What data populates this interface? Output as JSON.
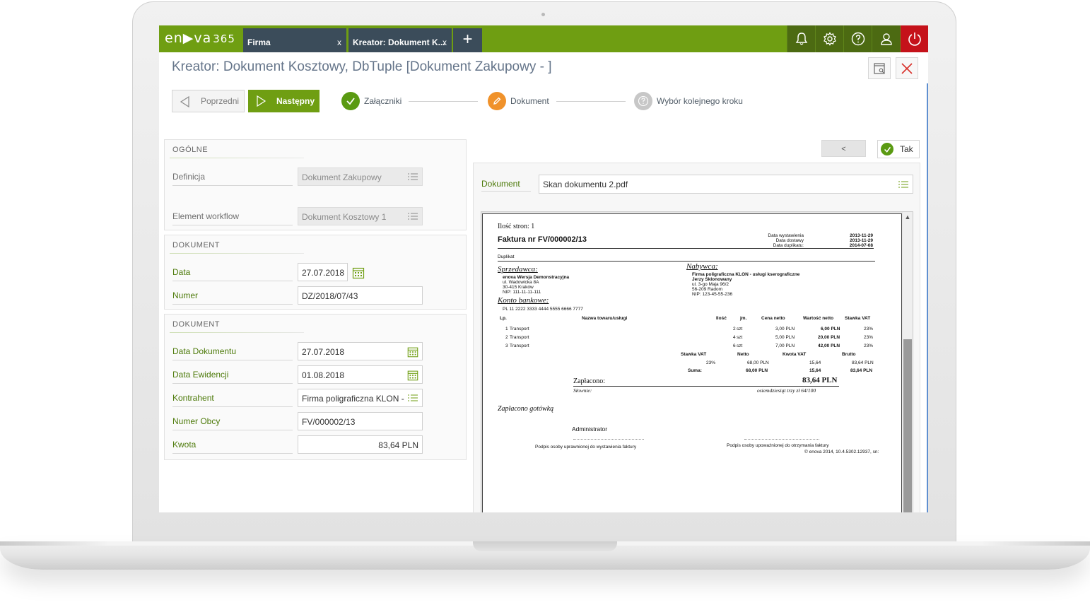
{
  "app": {
    "logo_main": "en▶va",
    "logo_num": "365"
  },
  "tabs": [
    {
      "label": "Firma",
      "close": "x"
    },
    {
      "label": "Kreator: Dokument K...",
      "close": "x"
    }
  ],
  "tab_add": "+",
  "header": {
    "title": "Kreator: Dokument Kosztowy, DbTuple [Dokument Zakupowy - ]"
  },
  "wizard": {
    "prev_label": "Poprzedni",
    "next_label": "Następny",
    "steps": [
      {
        "label": "Załączniki",
        "state": "done"
      },
      {
        "label": "Dokument",
        "state": "current"
      },
      {
        "label": "Wybór kolejnego kroku",
        "state": "pending"
      }
    ]
  },
  "sections": {
    "ogolne": {
      "title": "OGÓLNE",
      "fields": [
        {
          "label": "Definicja",
          "value": "Dokument Zakupowy"
        },
        {
          "label": "Element workflow",
          "value": "Dokument Kosztowy 1"
        }
      ]
    },
    "dokument1": {
      "title": "DOKUMENT",
      "fields": [
        {
          "label": "Data",
          "value": "27.07.2018"
        },
        {
          "label": "Numer",
          "value": "DZ/2018/07/43"
        }
      ]
    },
    "dokument2": {
      "title": "DOKUMENT",
      "fields": [
        {
          "label": "Data Dokumentu",
          "value": "27.07.2018"
        },
        {
          "label": "Data Ewidencji",
          "value": "01.08.2018"
        },
        {
          "label": "Kontrahent",
          "value": "Firma poligraficzna KLON - usługi kserograficzne"
        },
        {
          "label": "Numer Obcy",
          "value": "FV/000002/13"
        },
        {
          "label": "Kwota",
          "value": "83,64 PLN"
        }
      ]
    }
  },
  "right": {
    "back_label": "<",
    "tak_label": "Tak",
    "doc_label": "Dokument",
    "doc_value": "Skan dokumentu 2.pdf"
  },
  "invoice": {
    "pages": "Ilość stron: 1",
    "title": "Faktura nr FV/000002/13",
    "duplikat": "Duplikat",
    "dates_labels": [
      "Data wystawienia",
      "Data dostawy",
      "Data duplikatu:"
    ],
    "dates_values": [
      "2013-11-29",
      "2013-11-29",
      "2014-07-08"
    ],
    "seller_title": "Sprzedawca:",
    "seller_lines": [
      "enova Wersja Demonstracyjna",
      "ul. Wadowicka 8A",
      "30-415 Kraków",
      "NIP: 111-11-11-111"
    ],
    "bank_title": "Konto bankowe:",
    "bank_value": "PL 11 2222 3333 4444 5555 6666 7777",
    "buyer_title": "Nabywca:",
    "buyer_lines": [
      "Firma poligraficzna KLON - usługi kserograficzne",
      "Jerzy Sklonowany",
      "ul. 3-go Maja 96/2",
      "56-209 Radom",
      "NIP: 123-45-55-236"
    ],
    "table_headers": [
      "Lp.",
      "Nazwa towaru/usługi",
      "Ilość",
      "jm.",
      "Cena netto",
      "Wartość netto",
      "Stawka VAT"
    ],
    "rows": [
      [
        "1",
        "Transport",
        "2",
        "szt",
        "3,00 PLN",
        "6,00 PLN",
        "23%"
      ],
      [
        "2",
        "Transport",
        "4",
        "szt",
        "5,00 PLN",
        "20,00 PLN",
        "23%"
      ],
      [
        "3",
        "Transport",
        "6",
        "szt",
        "7,00 PLN",
        "42,00 PLN",
        "23%"
      ]
    ],
    "vat_headers": [
      "Stawka VAT",
      "Netto",
      "Kwota VAT",
      "Brutto"
    ],
    "vat_row": [
      "23%",
      "68,00 PLN",
      "15,64",
      "83,64 PLN"
    ],
    "sum_row": [
      "Suma:",
      "68,00 PLN",
      "15,64",
      "83,64 PLN"
    ],
    "paid_label": "Zapłacono:",
    "paid_value": "83,64 PLN",
    "words_label": "Słownie:",
    "words_value": "osiemdziesiąt trzy zł 64/100",
    "payment_method": "Zapłacono gotówką",
    "issuer": "Administrator",
    "sign_left": "Podpis osoby uprawnionej do wystawienia faktury",
    "sign_right": "Podpis osoby upoważnionej do otrzymania faktury",
    "footer": "© enova 2014, 10.4.5302.12937, sn:"
  },
  "colors": {
    "brand_green": "#6f9e12",
    "tab_dark": "#3b4c5a",
    "power_red": "#c5121a",
    "step_current": "#f0922b",
    "label_green": "#4d7a0a"
  }
}
